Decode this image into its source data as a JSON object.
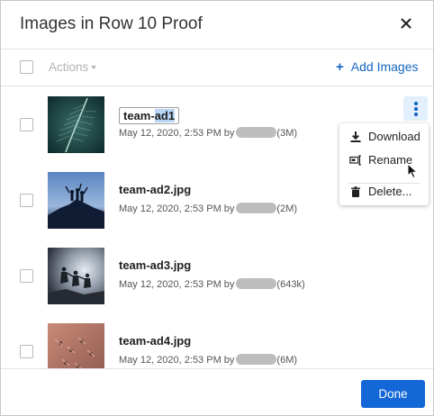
{
  "dialog": {
    "title": "Images in Row 10 Proof",
    "close_icon": "close-icon"
  },
  "toolbar": {
    "actions_label": "Actions",
    "add_images_label": "Add Images",
    "accent_color": "#1565c0"
  },
  "images": [
    {
      "name": "team-ad1",
      "name_unselected": "team-",
      "name_selected": "ad1",
      "date": "May 12, 2020, 2:53 PM",
      "by": "by",
      "size": "(3M)",
      "renaming": true
    },
    {
      "name": "team-ad2.jpg",
      "date": "May 12, 2020, 2:53 PM",
      "by": "by",
      "size": "(2M)"
    },
    {
      "name": "team-ad3.jpg",
      "date": "May 12, 2020, 2:53 PM",
      "by": "by",
      "size": "(643k)"
    },
    {
      "name": "team-ad4.jpg",
      "date": "May 12, 2020, 2:53 PM",
      "by": "by",
      "size": "(6M)"
    }
  ],
  "context_menu": {
    "items": [
      {
        "label": "Download",
        "icon": "download-icon"
      },
      {
        "label": "Rename",
        "icon": "rename-icon"
      },
      {
        "label": "Delete...",
        "icon": "trash-icon"
      }
    ]
  },
  "footer": {
    "done_label": "Done",
    "done_color": "#1467d6"
  }
}
